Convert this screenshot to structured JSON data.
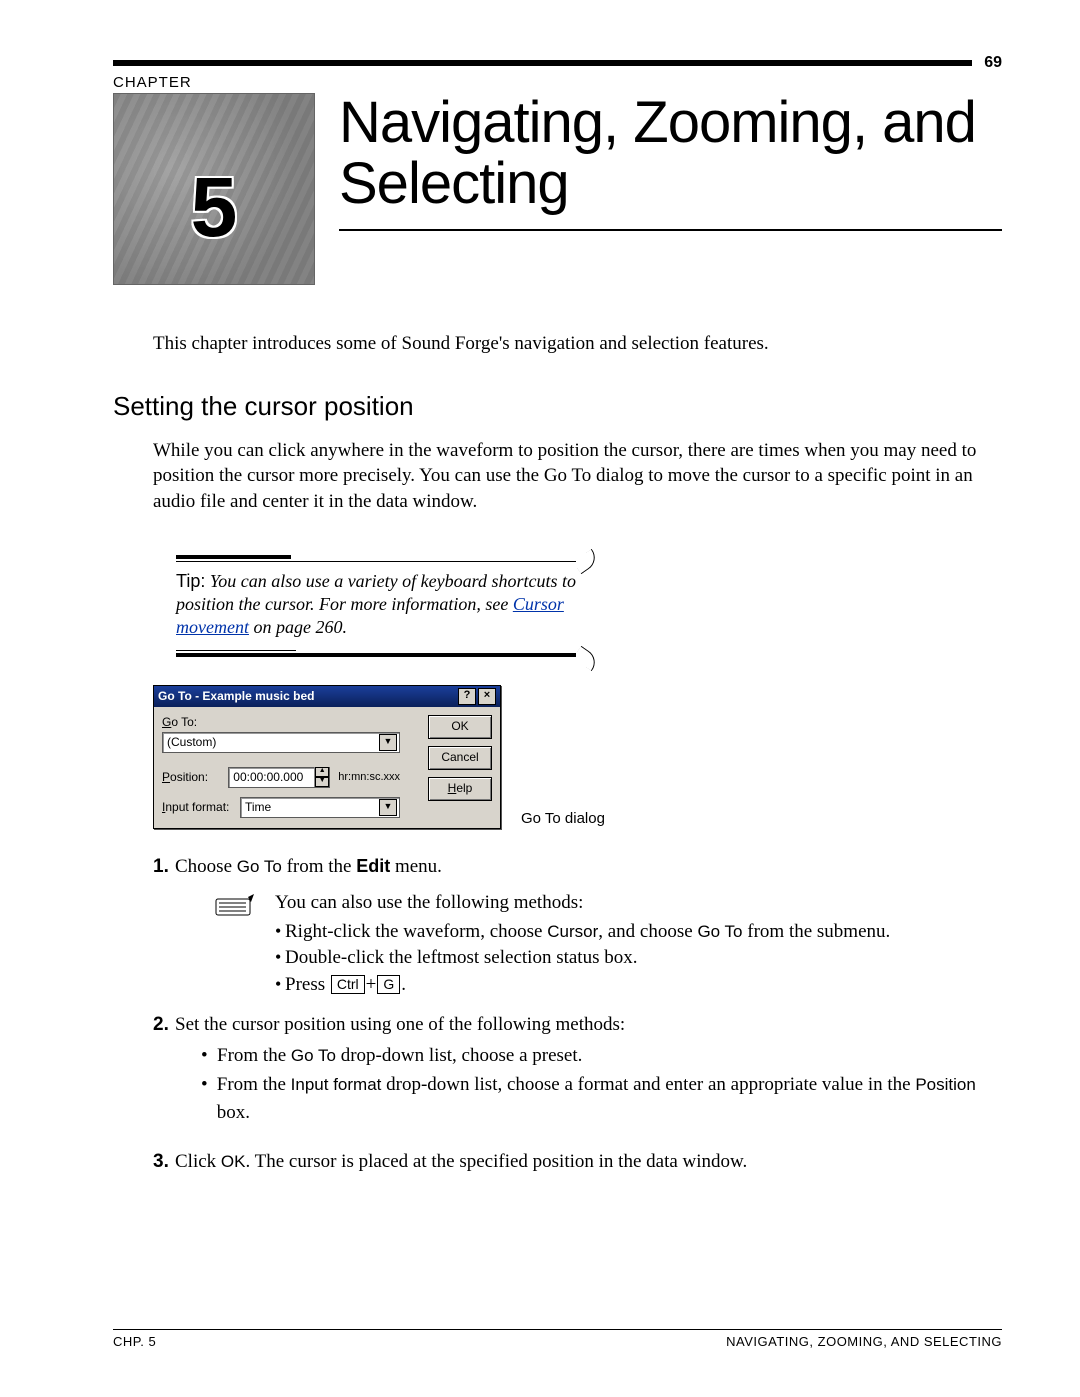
{
  "page_number": "69",
  "chapter_label": "CHAPTER",
  "chapter_number": "5",
  "chapter_title": "Navigating, Zooming, and Selecting",
  "intro": "This chapter introduces some of Sound Forge's navigation and selection features.",
  "section_heading": "Setting the cursor position",
  "section_para": "While you can click anywhere in the waveform to position the cursor, there are times when you may need to position the cursor more precisely. You can use the Go To dialog to move the cursor to a specific point in an audio file and center it in the data window.",
  "tip": {
    "label": "Tip:",
    "body_italic": "You can also use a variety of keyboard shortcuts to position the cursor. For more information, see ",
    "link_text": "Cursor movement",
    "tail_italic": " on page 260."
  },
  "dialog": {
    "title": "Go To - Example music bed",
    "help_btn": "?",
    "close_btn": "×",
    "goto_label_pre": "G",
    "goto_label_post": "o To:",
    "goto_value": "(Custom)",
    "position_label_pre": "P",
    "position_label_post": "osition:",
    "position_value": "00:00:00.000",
    "position_unit": "hr:mn:sc.xxx",
    "format_label_pre": "I",
    "format_label_post": "nput format:",
    "format_value": "Time",
    "ok": "OK",
    "cancel": "Cancel",
    "help_pre": "H",
    "help_post": "elp"
  },
  "dialog_caption": "Go To dialog",
  "steps": {
    "s1_pre": "Choose ",
    "s1_goto": "Go To",
    "s1_mid": " from the ",
    "s1_edit": "Edit",
    "s1_post": " menu.",
    "note_intro": "You can also use the following methods:",
    "nb1_pre": "Right-click the waveform, choose ",
    "nb1_cursor": "Cursor",
    "nb1_mid": ", and choose ",
    "nb1_goto": "Go To",
    "nb1_post": " from the submenu.",
    "nb2": "Double-click the leftmost selection status box.",
    "nb3_pre": "Press ",
    "key_ctrl": "Ctrl",
    "plus": "+",
    "key_g": "G",
    "nb3_post": ".",
    "s2_intro": "Set the cursor position using one of the following methods:",
    "s2b1_pre": "From the ",
    "s2b1_goto": "Go To",
    "s2b1_post": " drop-down list, choose a preset.",
    "s2b2_pre": "From the ",
    "s2b2_if": "Input format",
    "s2b2_mid": " drop-down list, choose a format and enter an appropriate value in the ",
    "s2b2_pos": "Position",
    "s2b2_post": " box.",
    "s3_pre": "Click ",
    "s3_ok": "OK",
    "s3_post": ". The cursor is placed at the specified position in the data window."
  },
  "footer_left": "CHP. 5",
  "footer_right": "NAVIGATING, ZOOMING, AND SELECTING"
}
